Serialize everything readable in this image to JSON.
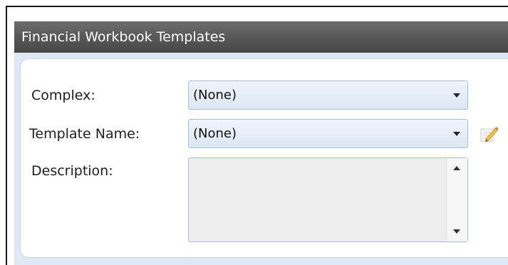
{
  "window": {
    "title": "Financial Workbook Templates"
  },
  "form": {
    "complex": {
      "label": "Complex:",
      "value": "(None)"
    },
    "template_name": {
      "label": "Template Name:",
      "value": "(None)"
    },
    "description": {
      "label": "Description:",
      "value": ""
    }
  },
  "icons": {
    "edit": "pencil-edit-icon",
    "dropdown": "chevron-down-icon",
    "scroll_up": "scroll-up-arrow-icon",
    "scroll_down": "scroll-down-arrow-icon"
  },
  "colors": {
    "titlebar": "#5a5a5a",
    "panel": "#dfe9f5",
    "field_border": "#a9bdd6"
  }
}
